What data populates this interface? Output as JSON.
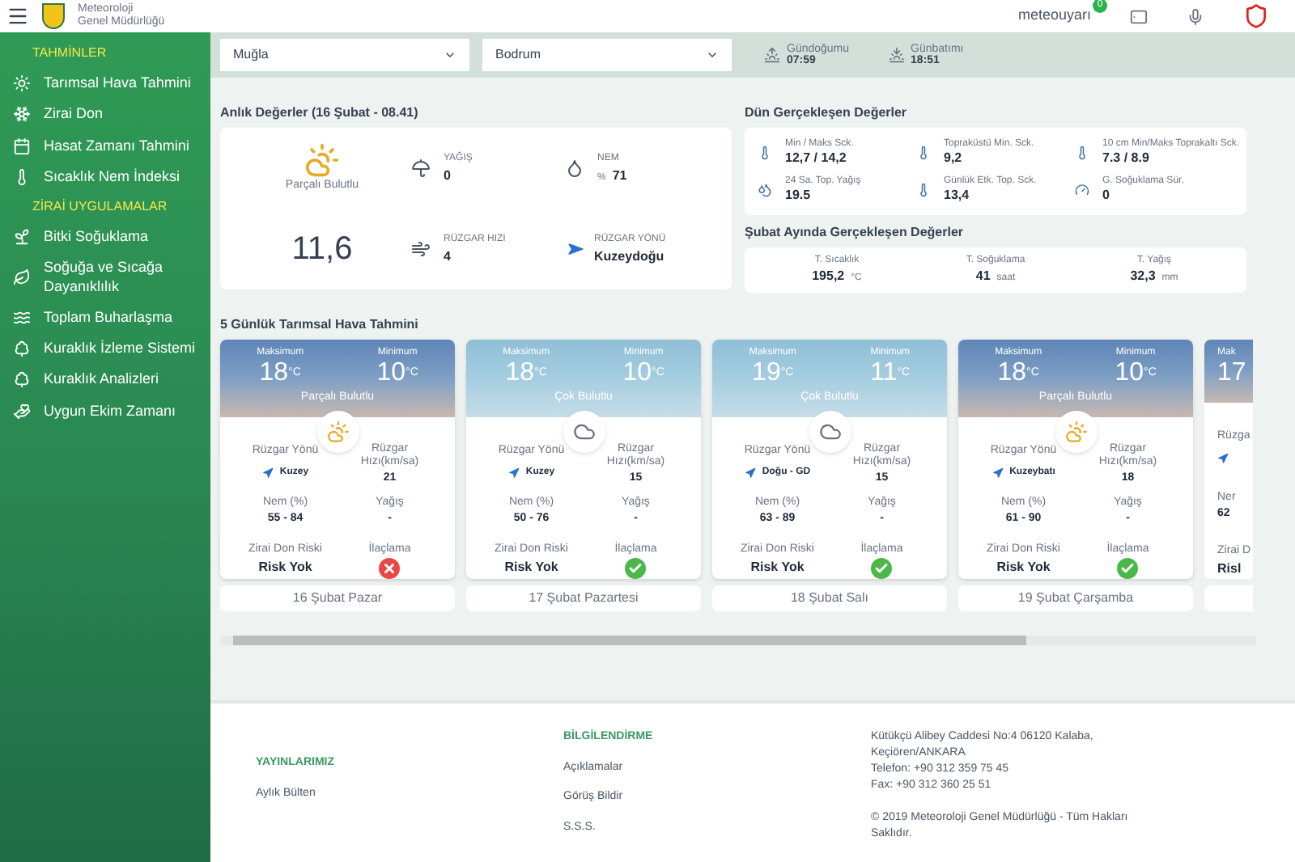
{
  "header": {
    "site_name": "Meteoroloji\nGenel Müdürlüğü",
    "brand": "meteouyarı",
    "brand_badge": "0"
  },
  "sidebar": {
    "sections": [
      {
        "title": "TAHMİNLER",
        "items": [
          {
            "label": "Tarımsal Hava Tahmini"
          },
          {
            "label": "Zirai Don"
          },
          {
            "label": "Hasat Zamanı Tahmini"
          },
          {
            "label": "Sıcaklık Nem İndeksi"
          }
        ]
      },
      {
        "title": "ZİRAİ UYGULAMALAR",
        "items": [
          {
            "label": "Bitki Soğuklama"
          },
          {
            "label": "Soğuğa ve Sıcağa Dayanıklılık"
          },
          {
            "label": "Toplam Buharlaşma"
          },
          {
            "label": "Kuraklık İzleme Sistemi"
          },
          {
            "label": "Kuraklık Analizleri"
          },
          {
            "label": "Uygun Ekim Zamanı"
          }
        ]
      }
    ]
  },
  "filters": {
    "province": "Muğla",
    "district": "Bodrum",
    "sunrise_label": "Gündoğumu",
    "sunrise": "07:59",
    "sunset_label": "Günbatımı",
    "sunset": "18:51"
  },
  "current": {
    "title": "Anlık Değerler (16 Şubat - 08.41)",
    "condition": "Parçalı Bulutlu",
    "temperature": "11,6",
    "rain_label": "YAĞIŞ",
    "rain": "0",
    "humidity_label": "NEM",
    "humidity_unit": "%",
    "humidity": "71",
    "wind_speed_label": "RÜZGAR HIZI",
    "wind_speed": "4",
    "wind_dir_label": "RÜZGAR YÖNÜ",
    "wind_dir": "Kuzeydoğu"
  },
  "yesterday": {
    "title": "Dün Gerçekleşen Değerler",
    "items": [
      {
        "label": "Min / Maks Sck.",
        "value": "12,7 / 14,2"
      },
      {
        "label": "Topraküstü Min. Sck.",
        "value": "9,2"
      },
      {
        "label": "10 cm Min/Maks Toprakaltı Sck.",
        "value": "7.3 / 8.9"
      },
      {
        "label": "24 Sa. Top. Yağış",
        "value": "19.5"
      },
      {
        "label": "Günlük Etk. Top. Sck.",
        "value": "13,4"
      },
      {
        "label": "G. Soğuklama Sür.",
        "value": "0"
      }
    ]
  },
  "month": {
    "title": "Şubat Ayında Gerçekleşen Değerler",
    "items": [
      {
        "label": "T. Sıcaklık",
        "value": "195,2",
        "unit": "°C"
      },
      {
        "label": "T. Soğuklama",
        "value": "41",
        "unit": "saat"
      },
      {
        "label": "T. Yağış",
        "value": "32,3",
        "unit": "mm"
      }
    ]
  },
  "forecast": {
    "title": "5 Günlük Tarımsal Hava Tahmini",
    "days": [
      {
        "kind": "partly",
        "max_label": "Maksimum",
        "max": "18",
        "max_unit": "°C",
        "min_label": "Minimum",
        "min": "10",
        "min_unit": "°C",
        "condition": "Parçalı Bulutlu",
        "wind_dir_label": "Rüzgar Yönü",
        "wind_dir": "Kuzey",
        "wind_speed_label": "Rüzgar Hızı(km/sa)",
        "wind_speed": "21",
        "humidity_label": "Nem (%)",
        "humidity": "55 - 84",
        "rain_label": "Yağış",
        "rain": "-",
        "frost_label": "Zirai Don Riski",
        "frost": "Risk Yok",
        "spray_label": "İlaçlama",
        "spray_ok": false,
        "date": "16 Şubat Pazar"
      },
      {
        "kind": "cloudy",
        "max_label": "Maksimum",
        "max": "18",
        "max_unit": "°C",
        "min_label": "Minimum",
        "min": "10",
        "min_unit": "°C",
        "condition": "Çok Bulutlu",
        "wind_dir_label": "Rüzgar Yönü",
        "wind_dir": "Kuzey",
        "wind_speed_label": "Rüzgar Hızı(km/sa)",
        "wind_speed": "15",
        "humidity_label": "Nem (%)",
        "humidity": "50 - 76",
        "rain_label": "Yağış",
        "rain": "-",
        "frost_label": "Zirai Don Riski",
        "frost": "Risk Yok",
        "spray_label": "İlaçlama",
        "spray_ok": true,
        "date": "17 Şubat Pazartesi"
      },
      {
        "kind": "cloudy",
        "max_label": "Maksimum",
        "max": "19",
        "max_unit": "°C",
        "min_label": "Minimum",
        "min": "11",
        "min_unit": "°C",
        "condition": "Çok Bulutlu",
        "wind_dir_label": "Rüzgar Yönü",
        "wind_dir": "Doğu - GD",
        "wind_speed_label": "Rüzgar Hızı(km/sa)",
        "wind_speed": "15",
        "humidity_label": "Nem (%)",
        "humidity": "63 - 89",
        "rain_label": "Yağış",
        "rain": "-",
        "frost_label": "Zirai Don Riski",
        "frost": "Risk Yok",
        "spray_label": "İlaçlama",
        "spray_ok": true,
        "date": "18 Şubat Salı"
      },
      {
        "kind": "partly",
        "max_label": "Maksimum",
        "max": "18",
        "max_unit": "°C",
        "min_label": "Minimum",
        "min": "10",
        "min_unit": "°C",
        "condition": "Parçalı Bulutlu",
        "wind_dir_label": "Rüzgar Yönü",
        "wind_dir": "Kuzeybatı",
        "wind_speed_label": "Rüzgar Hızı(km/sa)",
        "wind_speed": "18",
        "humidity_label": "Nem (%)",
        "humidity": "61 - 90",
        "rain_label": "Yağış",
        "rain": "-",
        "frost_label": "Zirai Don Riski",
        "frost": "Risk Yok",
        "spray_label": "İlaçlama",
        "spray_ok": true,
        "date": "19 Şubat Çarşamba"
      }
    ],
    "partial_day": {
      "kind": "partly",
      "max_label": "Mak",
      "max": "17",
      "wind_label": "Rüzga",
      "humidity_label": "Ner",
      "humidity": "62",
      "frost_label": "Zirai D",
      "frost": "Risl"
    }
  },
  "footer": {
    "columns": [
      {
        "title": "YAYINLARIMIZ",
        "links": [
          "Aylık Bülten"
        ]
      },
      {
        "title": "BİLGİLENDİRME",
        "links": [
          "Açıklamalar",
          "Görüş Bildir",
          "S.S.S."
        ]
      }
    ],
    "address": "Kütükçü Alibey Caddesi No:4 06120 Kalaba, Keçiören/ANKARA",
    "phone": "Telefon: +90 312 359 75 45",
    "fax": "Fax: +90 312 360 25 51",
    "copyright": "© 2019 Meteoroloji Genel Müdürlüğü - Tüm Hakları Saklıdır."
  }
}
